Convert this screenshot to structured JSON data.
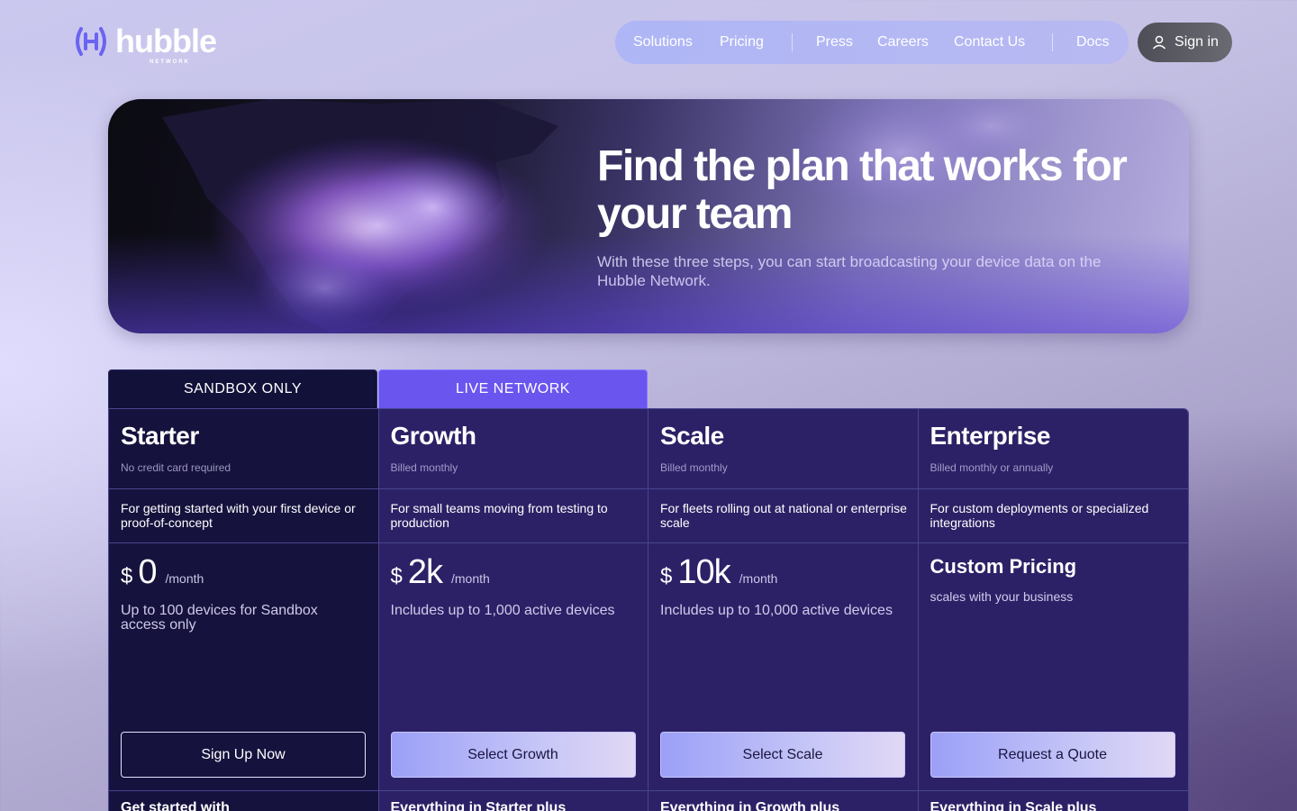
{
  "header": {
    "logo_text": "hubble",
    "logo_subtext": "NETWORK",
    "nav_items": [
      "Solutions",
      "Pricing",
      "Press",
      "Careers",
      "Contact Us",
      "Docs"
    ],
    "signin_label": "Sign in"
  },
  "hero": {
    "title": "Find the plan that  works for your team",
    "subtitle": "With these three steps, you can start broadcasting your device data on the Hubble Network."
  },
  "tabs": {
    "sandbox": "SANDBOX ONLY",
    "live": "LIVE NETWORK"
  },
  "plans": [
    {
      "name": "Starter",
      "billing": "No credit card required",
      "description": "For getting started with your first device or proof-of-concept",
      "currency": "$",
      "amount": "0",
      "period": "/month",
      "includes": "Up to 100 devices for Sandbox access only",
      "button": "Sign Up Now",
      "features_heading": "Get started with"
    },
    {
      "name": "Growth",
      "billing": "Billed monthly",
      "description": "For small teams moving from testing to production",
      "currency": "$",
      "amount": "2k",
      "period": "/month",
      "includes": "Includes up to 1,000 active devices",
      "button": "Select Growth",
      "features_heading": "Everything in Starter plus"
    },
    {
      "name": "Scale",
      "billing": "Billed monthly",
      "description": "For fleets rolling out at national or enterprise scale",
      "currency": "$",
      "amount": "10k",
      "period": "/month",
      "includes": "Includes up to 10,000 active devices",
      "button": "Select Scale",
      "features_heading": "Everything in Growth plus"
    },
    {
      "name": "Enterprise",
      "billing": "Billed monthly or annually",
      "description": "For custom deployments or specialized integrations",
      "custom_price": "Custom Pricing",
      "custom_note": "scales with your business",
      "button": "Request a Quote",
      "features_heading": "Everything in Scale plus"
    }
  ],
  "colors": {
    "tab_sandbox": "#12113a",
    "tab_live": "#6a55ef",
    "plan_starter_bg": "#15123d",
    "plan_bg": "#2c2166",
    "accent": "#6a55ef"
  }
}
